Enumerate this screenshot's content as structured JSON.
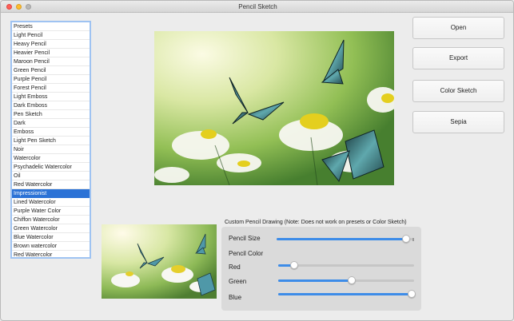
{
  "window": {
    "title": "Pencil Sketch"
  },
  "presets": {
    "header": "Presets",
    "items": [
      "Light Pencil",
      "Heavy Pencil",
      "Heavier Pencil",
      "Maroon Pencil",
      "Green Pencil",
      "Purple Pencil",
      "Forest Pencil",
      "Light Emboss",
      "Dark Emboss",
      "Pen Sketch",
      "Dark",
      "Emboss",
      "Light Pen Sketch",
      "Noir",
      "Watercolor",
      "Psychadelic Watercolor",
      "Oil",
      "Red Watercolor",
      "Impressionist",
      "Lined Watercolor",
      "Purple Water Color",
      "Chiffon Watercolor",
      "Green Watercolor",
      "Blue Watercolor",
      "Brown watercolor",
      "Red Watercolor"
    ],
    "selected": "Impressionist"
  },
  "buttons": {
    "open": "Open",
    "export": "Export",
    "color_sketch": "Color Sketch",
    "sepia": "Sepia"
  },
  "custom_panel": {
    "title": "Custom Pencil Drawing (Note: Does not work on presets or Color Sketch)",
    "pencil_size": {
      "label": "Pencil Size",
      "value": 0.95
    },
    "pencil_color_label": "Pencil Color",
    "red": {
      "label": "Red",
      "value": 0.12
    },
    "green": {
      "label": "Green",
      "value": 0.54
    },
    "blue": {
      "label": "Blue",
      "value": 0.98
    }
  },
  "colors": {
    "accent": "#3d8ce8",
    "selection": "#2b72d6"
  },
  "icons": {
    "close": "close-icon",
    "minimize": "minimize-icon",
    "maximize": "maximize-icon"
  }
}
